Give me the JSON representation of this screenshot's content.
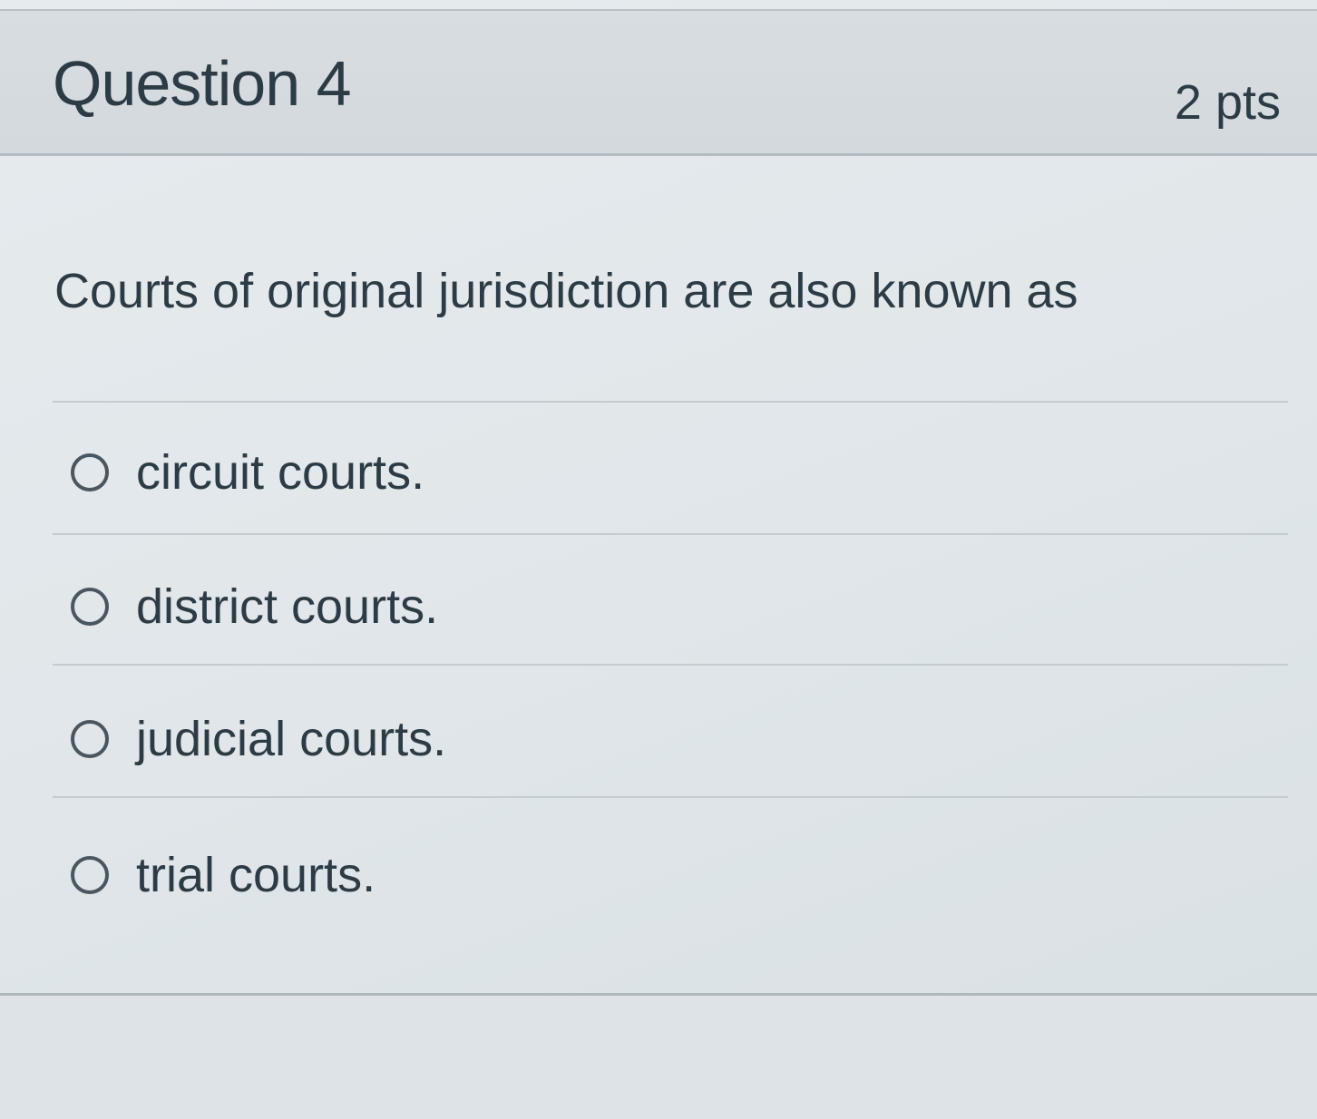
{
  "question": {
    "title": "Question 4",
    "points": "2 pts",
    "text": "Courts of original jurisdiction are also known as"
  },
  "answers": [
    {
      "label": "circuit courts.",
      "selected": false
    },
    {
      "label": "district courts.",
      "selected": false
    },
    {
      "label": "judicial courts.",
      "selected": false
    },
    {
      "label": "trial courts.",
      "selected": false
    }
  ]
}
